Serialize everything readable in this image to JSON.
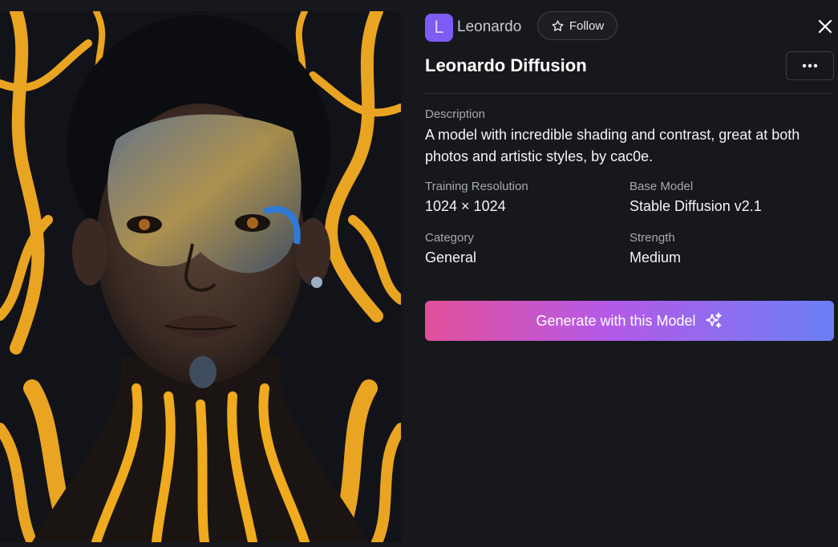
{
  "creator": {
    "avatar_letter": "L",
    "name": "Leonardo",
    "follow_label": "Follow"
  },
  "model": {
    "title": "Leonardo Diffusion",
    "description_label": "Description",
    "description": "A model with incredible shading and contrast, great at both photos and artistic styles, by cac0e.",
    "fields": [
      {
        "label": "Training Resolution",
        "value": "1024 × 1024"
      },
      {
        "label": "Base Model",
        "value": "Stable Diffusion v2.1"
      },
      {
        "label": "Category",
        "value": "General"
      },
      {
        "label": "Strength",
        "value": "Medium"
      }
    ]
  },
  "actions": {
    "generate_label": "Generate with this Model"
  },
  "icons": {
    "follow": "star-icon",
    "close": "close-icon",
    "more": "more-horizontal-icon",
    "generate": "sparkles-icon"
  },
  "colors": {
    "background": "#17181c",
    "avatar": "#7c5cf5",
    "gradient_start": "#e2509a",
    "gradient_mid": "#b45ae8",
    "gradient_end": "#6b7ff5"
  }
}
